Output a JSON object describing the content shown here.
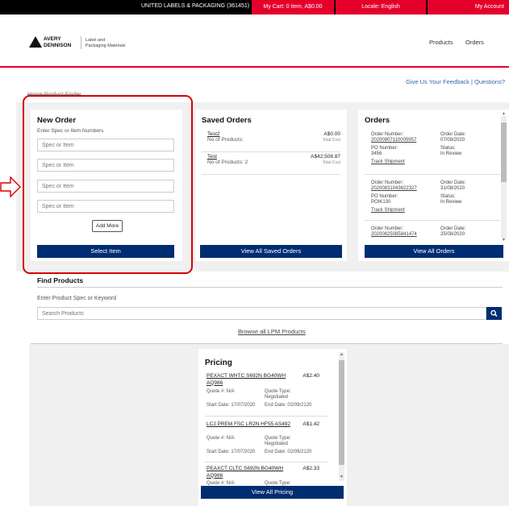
{
  "topbar": {
    "company": "UNITED LABELS & PACKAGING (361451)",
    "cart": "My Cart: 0 item, A$0.00",
    "locale": "Locale: English",
    "account": "My Account"
  },
  "header": {
    "logo_line1": "AVERY",
    "logo_line2": "DENNISON",
    "logo_sub1": "Label and",
    "logo_sub2": "Packaging Materials",
    "nav_products": "Products",
    "nav_orders": "Orders"
  },
  "feedback": "Give Us Your Feedback | Questions?",
  "breadcrumb": "Home  Product Finder",
  "new_order": {
    "title": "New Order",
    "hint": "Enter Spec or Item Numbers",
    "placeholder": "Spec or Item",
    "add_more": "Add More",
    "select": "Select Item"
  },
  "saved_orders": {
    "title": "Saved Orders",
    "items": [
      {
        "name": "Test2",
        "count": "No of Products:",
        "amount": "A$0.00",
        "label": "Total Cost"
      },
      {
        "name": "Test",
        "count": "No of Products: 2",
        "amount": "A$42,508.87",
        "label": "Total Cost"
      }
    ],
    "button": "View All Saved Orders"
  },
  "orders": {
    "title": "Orders",
    "items": [
      {
        "num_label": "Order Number:",
        "num": "20200907110005957",
        "date_label": "Order Date:",
        "date": "07/09/2020",
        "po_label": "PO Number:",
        "po": "3456",
        "status_label": "Status:",
        "status": "In Review",
        "track": "Track Shipment"
      },
      {
        "num_label": "Order Number:",
        "num": "20200831043622327",
        "date_label": "Order Date:",
        "date": "31/08/2020",
        "po_label": "PO Number:",
        "po": "POIK130",
        "status_label": "Status:",
        "status": "In Review",
        "track": "Track Shipment"
      },
      {
        "num_label": "Order Number:",
        "num": "20200825085841474",
        "date_label": "Order Date:",
        "date": "25/08/2020"
      }
    ],
    "button": "View All Orders"
  },
  "find": {
    "title": "Find Products",
    "hint": "Enter Product Spec or Keyword",
    "placeholder": "Search Products",
    "browse": "Browse all LPM Products"
  },
  "pricing": {
    "title": "Pricing",
    "items": [
      {
        "name": "PEXACT WHTC S692N BG40WH AQ986",
        "price": "A$2.40",
        "quote": "Quote #: N/A",
        "type": "Quote Type:",
        "type_val": "Negotiated",
        "start": "Start Date: 17/07/2020",
        "end": "End Date: 02/09/2120"
      },
      {
        "name": "LCJ PREM FSC LR2N HF55 AS492",
        "price": "A$1.42",
        "quote": "Quote #: N/A",
        "type": "Quote Type:",
        "type_val": "Negotiated",
        "start": "Start Date: 17/07/2020",
        "end": "End Date: 02/09/2120"
      },
      {
        "name": "PEAXCT CLTC S692N BG40WH AQ986",
        "price": "A$2.33",
        "quote": "Quote #: N/A",
        "type": "Quote Type:"
      }
    ],
    "button": "View All Pricing"
  }
}
